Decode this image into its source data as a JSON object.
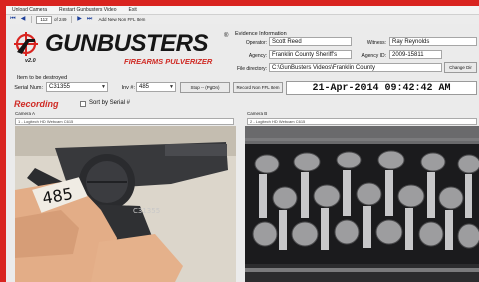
{
  "menu": [
    "Unload Camera",
    "Restart Gunbusters Video",
    "Exit"
  ],
  "toolbar": {
    "first_icon": "⏮",
    "prev_icon": "◀",
    "record_position": "112",
    "record_count": "of 249",
    "next_icon": "▶",
    "last_icon": "⏭",
    "new_non_ffl_label": "Add New Non FFL Item"
  },
  "logo": {
    "brand": "GUNBUSTERS",
    "registered": "®",
    "version": "v2.0",
    "tagline": "FIREARMS PULVERIZER"
  },
  "evidence": {
    "title": "Evidence Information",
    "operator_label": "Operator:",
    "operator_value": "Scott Reed",
    "witness_label": "Witness:",
    "witness_value": "Ray Reynolds",
    "agency_label": "Agency:",
    "agency_value": "Franklin County Sheriff's",
    "agency_id_label": "Agency ID:",
    "agency_id_value": "2009-15811",
    "file_dir_label": "File directory:",
    "file_dir_value": "C:\\GunBusters Videos\\Franklin County",
    "change_dir_label": "Change Dir"
  },
  "item": {
    "title": "Item to be destroyed",
    "serial_label": "Serial Num:",
    "serial_value": "C31355",
    "inv_label": "Inv #:",
    "inv_value": "485",
    "stop_label": "Stop -- (PgDn)",
    "record_non_ffl_label": "Record Non FFL Item",
    "datetime": "21-Apr-2014 09:42:42 AM"
  },
  "recording": {
    "label": "Recording",
    "sort_label": "Sort by Serial #",
    "sort_checked": false
  },
  "cameras": [
    {
      "title": "Camera A",
      "device": "1 - Logitech HD Webcam C615"
    },
    {
      "title": "Camera B",
      "device": "2 - Logitech HD Webcam C615"
    }
  ],
  "photo": {
    "tag_number": "485",
    "engraved_serial": "C31355"
  },
  "colors": {
    "brand_red": "#d92420",
    "accent_red": "#cf2a24",
    "toolbar_blue": "#1d3f9a"
  }
}
